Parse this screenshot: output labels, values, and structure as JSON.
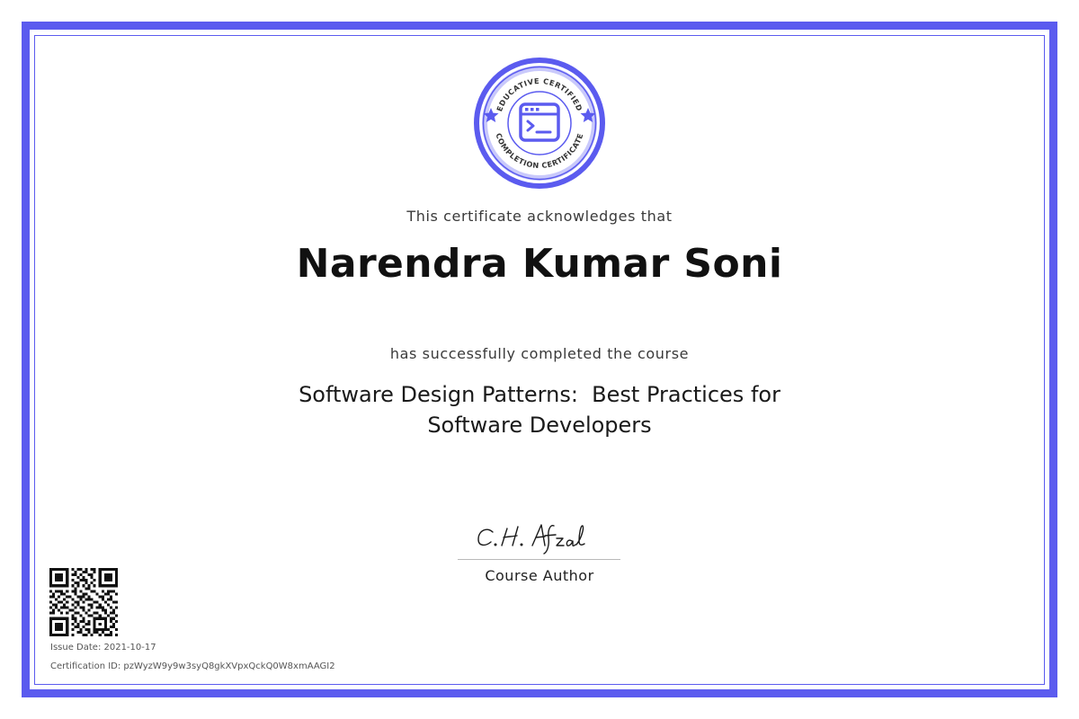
{
  "certificate": {
    "badge": {
      "arc_top_text": "EDUCATIVE CERTIFIED",
      "arc_bottom_text": "COMPLETION CERTIFICATE",
      "icon": "terminal-window-icon",
      "star_icon": "star-icon"
    },
    "acknowledge_text": "This certificate acknowledges that",
    "recipient_name": "Narendra Kumar Soni",
    "completed_text": "has successfully completed the course",
    "course_title": "Software Design Patterns:  Best Practices for\nSoftware Developers",
    "signature": {
      "name": "C. H. Afzal",
      "role": "Course Author"
    },
    "issue_date": "Issue Date: 2021-10-17",
    "certification_id": "Certification ID: pzWyzW9y9w3syQ8gkXVpxQckQ0W8xmAAGI2",
    "qr_icon": "qr-code-icon"
  },
  "colors": {
    "accent": "#5B5BEF",
    "badge_light": "#C9C9FB",
    "text_dark": "#111111",
    "text_muted": "#3a3a3a"
  }
}
